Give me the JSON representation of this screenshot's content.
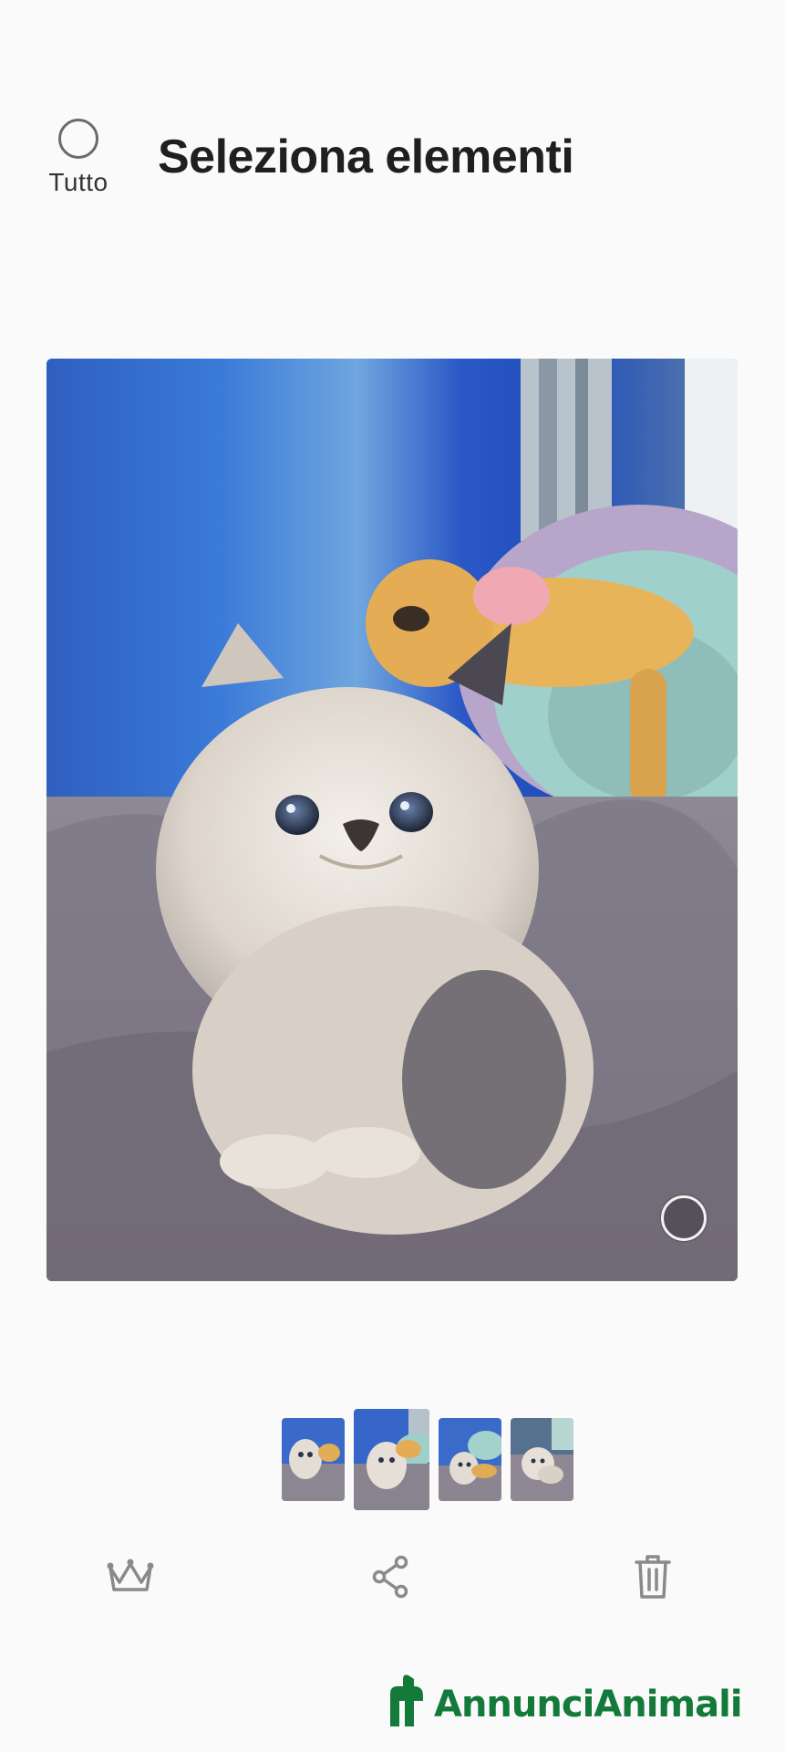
{
  "header": {
    "select_all_label": "Tutto",
    "title": "Seleziona elementi"
  },
  "main_photo": {
    "subject": "photo",
    "selected": false
  },
  "thumbnails": [
    {
      "name": "thumbnail-1",
      "active": false
    },
    {
      "name": "thumbnail-2",
      "active": true
    },
    {
      "name": "thumbnail-3",
      "active": false
    },
    {
      "name": "thumbnail-4",
      "active": false
    }
  ],
  "actions": [
    {
      "name": "crown-icon",
      "label": ""
    },
    {
      "name": "share-icon",
      "label": ""
    },
    {
      "name": "trash-icon",
      "label": ""
    }
  ],
  "watermark": {
    "text": "AnnunciAnimali",
    "color": "#137a3a"
  },
  "colors": {
    "background": "#fafafa",
    "title": "#1f1f1f",
    "icon": "#8a8a8a"
  }
}
